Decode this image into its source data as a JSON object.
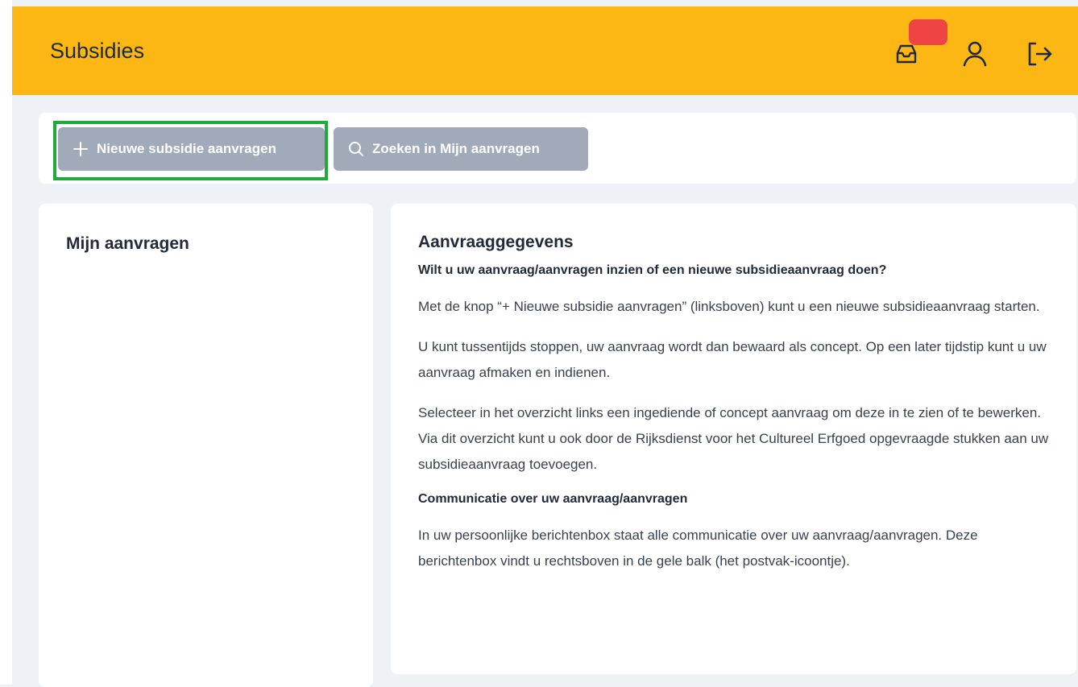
{
  "header": {
    "title": "Subsidies",
    "inbox_icon": "inbox-icon",
    "user_icon": "user-icon",
    "logout_icon": "logout-icon",
    "bg_color": "#fdb714",
    "badge_color": "#ef4444"
  },
  "toolbar": {
    "new_label": "Nieuwe subsidie aanvragen",
    "search_label": "Zoeken in Mijn aanvragen",
    "highlight_color": "#1faa3a"
  },
  "sidebar": {
    "title": "Mijn aanvragen"
  },
  "details": {
    "title": "Aanvraaggegevens",
    "question": "Wilt u uw aanvraag/aanvragen inzien of een nieuwe subsidieaanvraag doen?",
    "p1": "Met de knop “+ Nieuwe subsidie aanvragen” (linksboven) kunt u een nieuwe subsidieaanvraag starten.",
    "p2": "U kunt tussentijds stoppen, uw aanvraag wordt dan bewaard als concept. Op een later tijdstip kunt u uw aanvraag afmaken en indienen.",
    "p3": "Selecteer in het overzicht links een ingediende of concept aanvraag om deze in te zien of te bewerken. Via dit overzicht kunt u ook door de Rijksdienst voor het Cultureel Erfgoed opgevraagde stukken aan uw subsidieaanvraag toevoegen.",
    "comm_title": "Communicatie over uw aanvraag/aanvragen",
    "p4": "In uw persoonlijke berichtenbox staat alle communicatie over uw aanvraag/aanvragen. Deze berichtenbox vindt u rechtsboven in de gele balk (het postvak-icoontje)."
  }
}
